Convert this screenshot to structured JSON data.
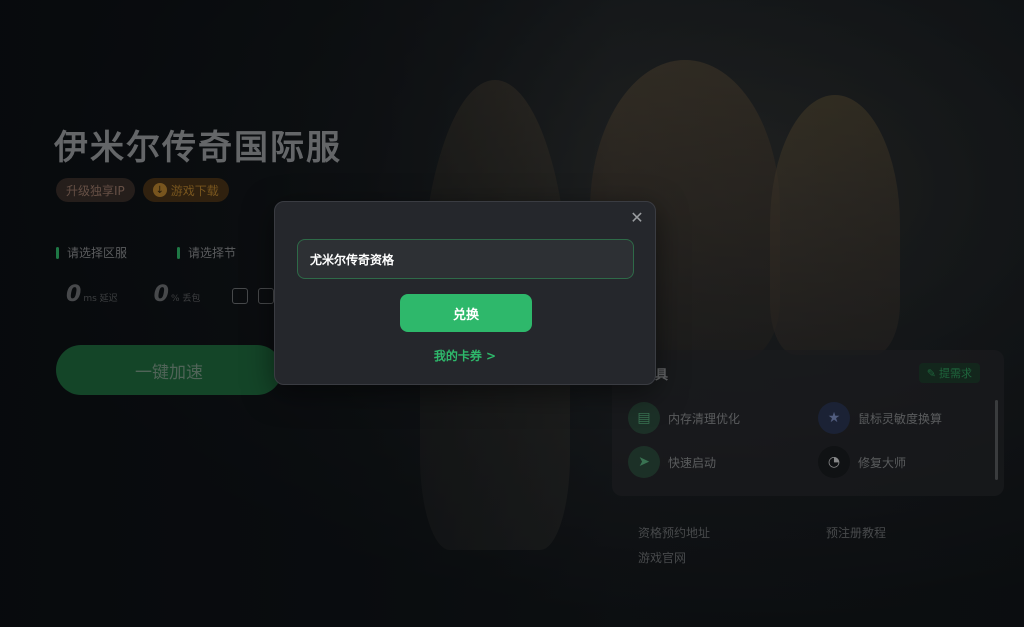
{
  "game": {
    "title": "伊米尔传奇国际服",
    "badge_ip": "升级独享IP",
    "badge_download": "游戏下载"
  },
  "selectors": {
    "region": "请选择区服",
    "node": "请选择节"
  },
  "stats": {
    "latency_value": "0",
    "latency_unit": "ms 延迟",
    "loss_value": "0",
    "loss_unit": "% 丢包"
  },
  "accelerate_button": "一键加速",
  "tools": {
    "title": "工具",
    "request_badge": "提需求",
    "items": [
      {
        "label": "内存清理优化",
        "icon": "memory-clean-icon"
      },
      {
        "label": "鼠标灵敏度换算",
        "icon": "mouse-sensitivity-icon"
      },
      {
        "label": "快速启动",
        "icon": "quick-launch-icon"
      },
      {
        "label": "修复大师",
        "icon": "repair-master-icon"
      }
    ]
  },
  "links": {
    "reservation": "资格预约地址",
    "official_site": "游戏官网",
    "preregister_tutorial": "预注册教程"
  },
  "modal": {
    "input_value": "尤米尔传奇资格",
    "redeem_button": "兑换",
    "my_coupons": "我的卡券 >"
  },
  "colors": {
    "accent": "#2eb86b",
    "modal_bg": "#25272c"
  }
}
